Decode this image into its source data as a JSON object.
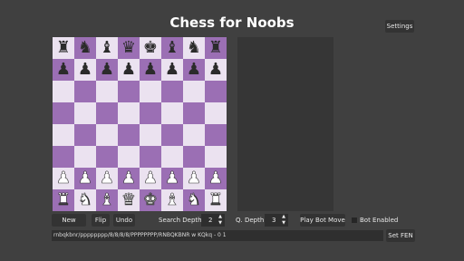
{
  "title": "Chess for Noobs",
  "settings_label": "Settings",
  "controls": {
    "new_game": "New Game",
    "flip": "Flip",
    "undo": "Undo",
    "search_depth_label": "Search Depth",
    "search_depth_value": "2",
    "q_depth_label": "Q. Depth",
    "q_depth_value": "3",
    "play_bot_move": "Play Bot Move",
    "bot_enabled_label": "Bot Enabled",
    "bot_enabled_checked": false
  },
  "fen": {
    "value": "rnbqkbnr/pppppppp/8/8/8/8/PPPPPPPP/RNBQKBNR w KQkq - 0 1",
    "set_label": "Set FEN"
  },
  "board": {
    "light_color": "#ebe2f0",
    "dark_color": "#9b6fb4",
    "ranks": [
      "rnbqkbnr",
      "pppppppp",
      "........",
      "........",
      "........",
      "........",
      "PPPPPPPP",
      "RNBQKBNR"
    ]
  }
}
